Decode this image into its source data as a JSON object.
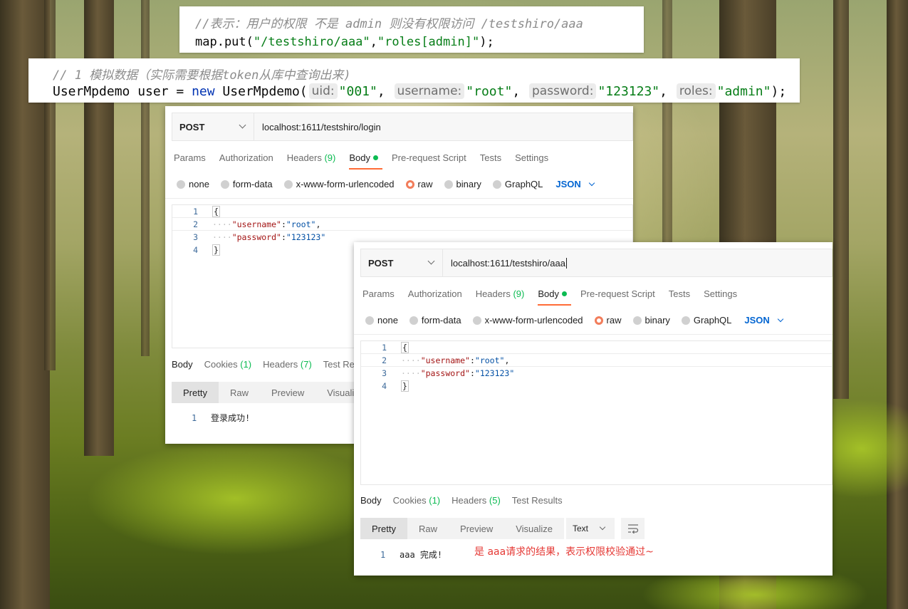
{
  "code_snippet_1": {
    "comment": "//表示：用户的权限 不是 admin 则没有权限访问 /testshiro/aaa",
    "line_prefix": "map.put(",
    "path_str": "\"/testshiro/aaa\"",
    "comma": ",",
    "roles_str": "\"roles[admin]\"",
    "line_suffix": ");"
  },
  "code_snippet_2": {
    "comment": "// 1 模拟数据（实际需要根据token从库中查询出来)",
    "decl": "UserMpdemo user = ",
    "kw_new": "new",
    "ctor": " UserMpdemo(",
    "args": [
      {
        "hint": "uid:",
        "value": "\"001\"",
        "sep": ", "
      },
      {
        "hint": "username:",
        "value": "\"root\"",
        "sep": ", "
      },
      {
        "hint": "password:",
        "value": "\"123123\"",
        "sep": ", "
      },
      {
        "hint": "roles:",
        "value": "\"admin\"",
        "sep": ");"
      }
    ]
  },
  "request_login": {
    "method": "POST",
    "url": "localhost:1611/testshiro/login",
    "tabs": {
      "params": "Params",
      "authorization": "Authorization",
      "headers": "Headers",
      "headers_count": "(9)",
      "body": "Body",
      "prerequest": "Pre-request Script",
      "tests": "Tests",
      "settings": "Settings"
    },
    "body_types": {
      "none": "none",
      "form_data": "form-data",
      "urlencoded": "x-www-form-urlencoded",
      "raw": "raw",
      "binary": "binary",
      "graphql": "GraphQL",
      "format": "JSON"
    },
    "editor": {
      "l1": "1",
      "l2": "2",
      "l3": "3",
      "l4": "4",
      "open": "{",
      "close": "}",
      "indent": "····",
      "k_user": "\"username\"",
      "v_user": "\"root\"",
      "k_pass": "\"password\"",
      "v_pass": "\"123123\"",
      "colon": ":",
      "comma": ","
    },
    "response_tabs": {
      "body": "Body",
      "cookies": "Cookies",
      "cookies_count": "(1)",
      "headers": "Headers",
      "headers_count": "(7)",
      "test_results": "Test Res"
    },
    "view_modes": {
      "pretty": "Pretty",
      "raw": "Raw",
      "preview": "Preview",
      "visualize": "Visuali"
    },
    "response_body": {
      "line": "1",
      "text": "登录成功!"
    }
  },
  "request_aaa": {
    "method": "POST",
    "url": "localhost:1611/testshiro/aaa",
    "tabs": {
      "params": "Params",
      "authorization": "Authorization",
      "headers": "Headers",
      "headers_count": "(9)",
      "body": "Body",
      "prerequest": "Pre-request Script",
      "tests": "Tests",
      "settings": "Settings"
    },
    "body_types": {
      "none": "none",
      "form_data": "form-data",
      "urlencoded": "x-www-form-urlencoded",
      "raw": "raw",
      "binary": "binary",
      "graphql": "GraphQL",
      "format": "JSON"
    },
    "editor": {
      "l1": "1",
      "l2": "2",
      "l3": "3",
      "l4": "4",
      "open": "{",
      "close": "}",
      "indent": "····",
      "k_user": "\"username\"",
      "v_user": "\"root\"",
      "k_pass": "\"password\"",
      "v_pass": "\"123123\"",
      "colon": ":",
      "comma": ","
    },
    "response_tabs": {
      "body": "Body",
      "cookies": "Cookies",
      "cookies_count": "(1)",
      "headers": "Headers",
      "headers_count": "(5)",
      "test_results": "Test Results"
    },
    "view_modes": {
      "pretty": "Pretty",
      "raw": "Raw",
      "preview": "Preview",
      "visualize": "Visualize"
    },
    "format_select": "Text",
    "response_body": {
      "line": "1",
      "text": "aaa 完成!"
    },
    "annotation": "是 aaa请求的结果，表示权限校验通过~",
    "annotation_color": "#e53935"
  },
  "colors": {
    "accent": "#ff6c37",
    "active_dot": "#0cbb52",
    "json_blue": "#0265d2"
  }
}
